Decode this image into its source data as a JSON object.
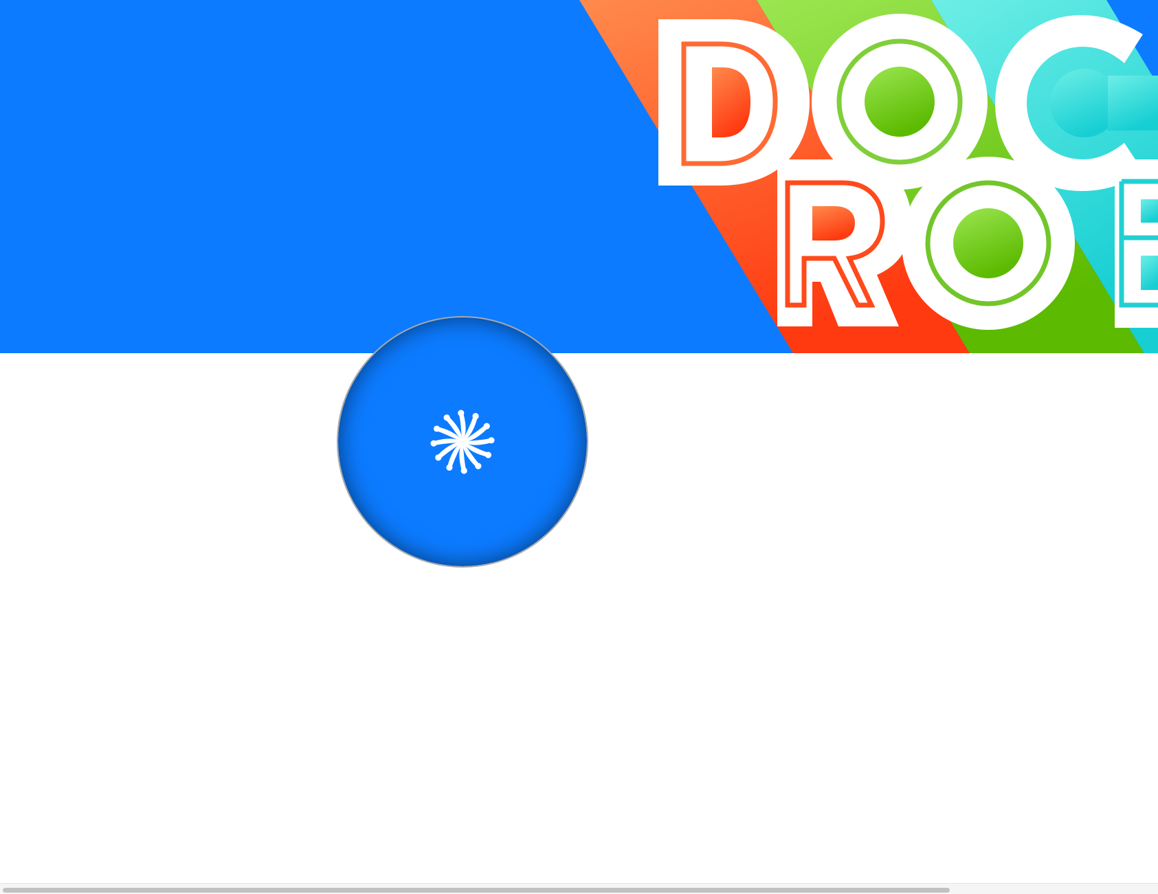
{
  "colors": {
    "banner_blue": "#0c7bff",
    "stripe_orange": "#ff5a2a",
    "stripe_green": "#7ed23a",
    "stripe_cyan": "#3fd8d8",
    "letter_white": "#ffffff",
    "page_background": "#ffffff",
    "scrollbar_thumb": "#c1c1c1"
  },
  "banner": {
    "logo_line1": "DOC",
    "logo_line2": "ROB"
  },
  "loader": {
    "icon": "spinner-icon"
  },
  "scrollbar": {
    "orientation": "horizontal"
  }
}
